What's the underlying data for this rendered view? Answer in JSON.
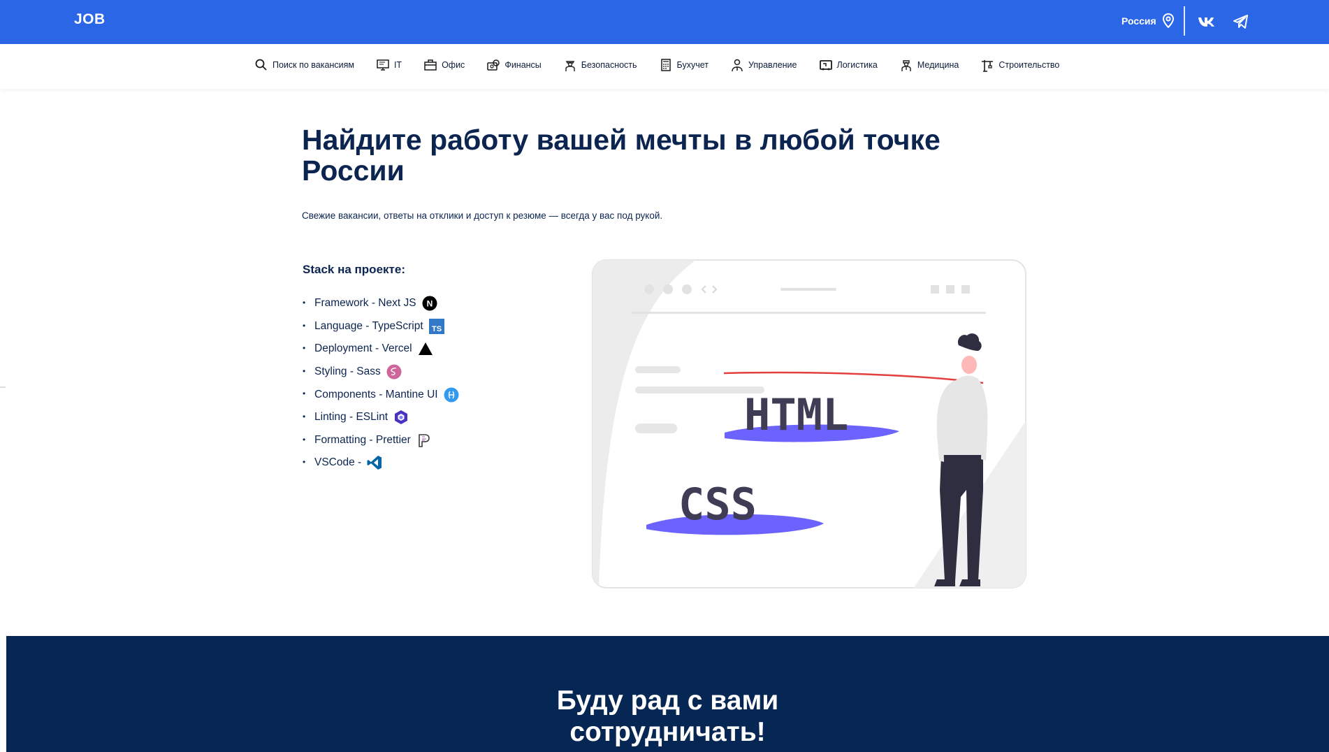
{
  "header": {
    "logo": "JOB",
    "region": "Россия",
    "icons": {
      "location": "location-pin-icon",
      "vk": "vk-icon",
      "telegram": "telegram-icon"
    },
    "colors": {
      "bar": "#2b66e6"
    }
  },
  "categories": [
    {
      "label": "Поиск по вакансиям",
      "icon": "search-icon"
    },
    {
      "label": "IT",
      "icon": "monitor-icon"
    },
    {
      "label": "Офис",
      "icon": "briefcase-icon"
    },
    {
      "label": "Финансы",
      "icon": "money-icon"
    },
    {
      "label": "Безопасность",
      "icon": "guard-icon"
    },
    {
      "label": "Бухучет",
      "icon": "calculator-icon"
    },
    {
      "label": "Управление",
      "icon": "manager-icon"
    },
    {
      "label": "Логистика",
      "icon": "truck-icon"
    },
    {
      "label": "Медицина",
      "icon": "doctor-icon"
    },
    {
      "label": "Строительство",
      "icon": "crane-icon"
    }
  ],
  "hero": {
    "title": "Найдите работу вашей мечты в любой точке России",
    "subtitle": "Свежие вакансии, ответы на отклики и доступ к резюме — всегда у вас под рукой."
  },
  "stack": {
    "title": "Stack на проекте:",
    "items": [
      {
        "label": "Framework - Next JS",
        "icon": "nextjs-icon"
      },
      {
        "label": "Language - TypeScript",
        "icon": "typescript-icon"
      },
      {
        "label": "Deployment - Vercel",
        "icon": "vercel-icon"
      },
      {
        "label": "Styling - Sass",
        "icon": "sass-icon"
      },
      {
        "label": "Components - Mantine UI",
        "icon": "mantine-icon"
      },
      {
        "label": "Linting - ESLint",
        "icon": "eslint-icon"
      },
      {
        "label": "Formatting - Prettier",
        "icon": "prettier-icon"
      },
      {
        "label": "VSCode -",
        "icon": "vscode-icon"
      }
    ]
  },
  "illustration": {
    "words": [
      "HTML",
      "CSS"
    ]
  },
  "banner": {
    "line1": "Буду рад с вами",
    "line2": "сотрудничать!",
    "color": "#062653"
  }
}
